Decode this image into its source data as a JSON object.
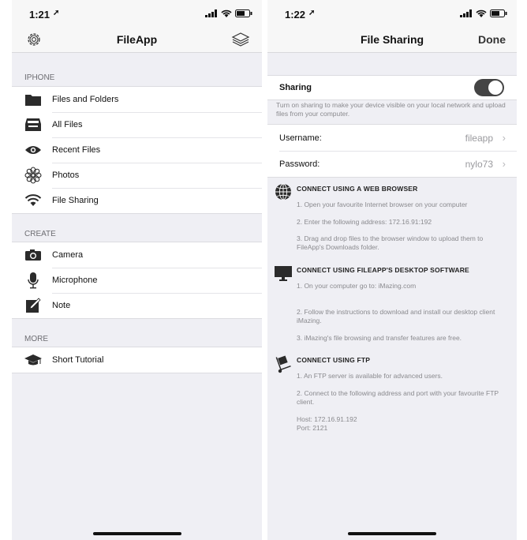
{
  "left": {
    "status_time": "1:21",
    "nav_title": "FileApp",
    "sections": [
      {
        "header": "IPHONE",
        "items": [
          {
            "label": "Files and Folders",
            "icon": "folder-icon"
          },
          {
            "label": "All Files",
            "icon": "tray-icon"
          },
          {
            "label": "Recent Files",
            "icon": "eye-icon"
          },
          {
            "label": "Photos",
            "icon": "flower-icon"
          },
          {
            "label": "File Sharing",
            "icon": "wifi-icon"
          }
        ]
      },
      {
        "header": "CREATE",
        "items": [
          {
            "label": "Camera",
            "icon": "camera-icon"
          },
          {
            "label": "Microphone",
            "icon": "microphone-icon"
          },
          {
            "label": "Note",
            "icon": "note-icon"
          }
        ]
      },
      {
        "header": "MORE",
        "items": [
          {
            "label": "Short Tutorial",
            "icon": "graduation-cap-icon"
          }
        ]
      }
    ]
  },
  "right": {
    "status_time": "1:22",
    "nav_title": "File Sharing",
    "done_label": "Done",
    "sharing_label": "Sharing",
    "sharing_on": true,
    "sharing_desc": "Turn on sharing to make your device visible on your local network and upload files from your computer.",
    "username_label": "Username:",
    "username_value": "fileapp",
    "password_label": "Password:",
    "password_value": "nylo73",
    "web": {
      "title": "CONNECT USING A WEB BROWSER",
      "steps": [
        "1. Open your favourite Internet browser on your computer",
        "2. Enter the following address: 172.16.91:192",
        "3. Drag and drop files to the browser window to upload them to FileApp's Downloads folder."
      ]
    },
    "desktop": {
      "title": "CONNECT USING FILEAPP'S DESKTOP SOFTWARE",
      "steps": [
        "1. On your computer go to: iMazing.com",
        "2. Follow the instructions to download and install our desktop client iMazing.",
        "3. iMazing's file browsing and transfer features are free."
      ]
    },
    "ftp": {
      "title": "CONNECT USING FTP",
      "steps": [
        "1. An FTP server is available for advanced users.",
        "2. Connect to the following address and port with your favourite FTP client.",
        "Host: 172.16.91.192",
        "Port:  2121"
      ]
    }
  }
}
